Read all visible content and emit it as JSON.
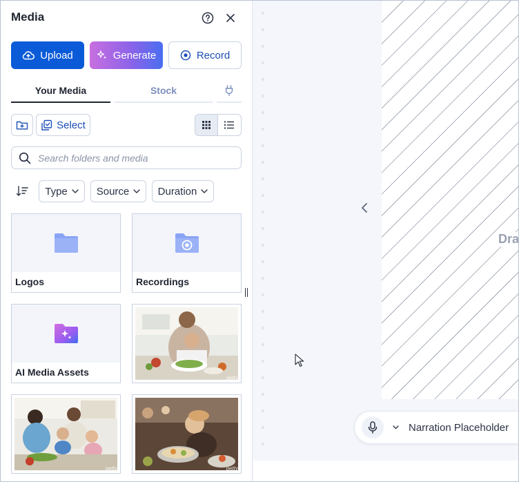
{
  "panel": {
    "title": "Media",
    "help_icon": "help-circle-icon",
    "close_icon": "close-icon"
  },
  "actions": {
    "upload": "Upload",
    "generate": "Generate",
    "record": "Record"
  },
  "tabs": [
    {
      "label": "Your Media",
      "active": true
    },
    {
      "label": "Stock",
      "active": false
    },
    {
      "icon": "plug-icon"
    }
  ],
  "toolbar": {
    "select_label": "Select",
    "view_mode": "grid"
  },
  "search": {
    "placeholder": "Search folders and media"
  },
  "filters": {
    "type": "Type",
    "source": "Source",
    "duration": "Duration"
  },
  "media": {
    "folders": [
      {
        "label": "Logos",
        "icon": "folder-icon"
      },
      {
        "label": "Recordings",
        "icon": "recordings-folder-icon"
      },
      {
        "label": "AI Media Assets",
        "icon": "ai-folder-icon"
      }
    ],
    "images": [
      {
        "watermark": "getty"
      },
      {
        "watermark": "getty"
      },
      {
        "watermark": "getty"
      }
    ]
  },
  "canvas": {
    "drop_text": "Dra",
    "narration_label": "Narration Placeholder"
  },
  "colors": {
    "primary": "#0b5bd8",
    "accent_text": "#1c4fb8",
    "folder": "#8aa4f5"
  }
}
